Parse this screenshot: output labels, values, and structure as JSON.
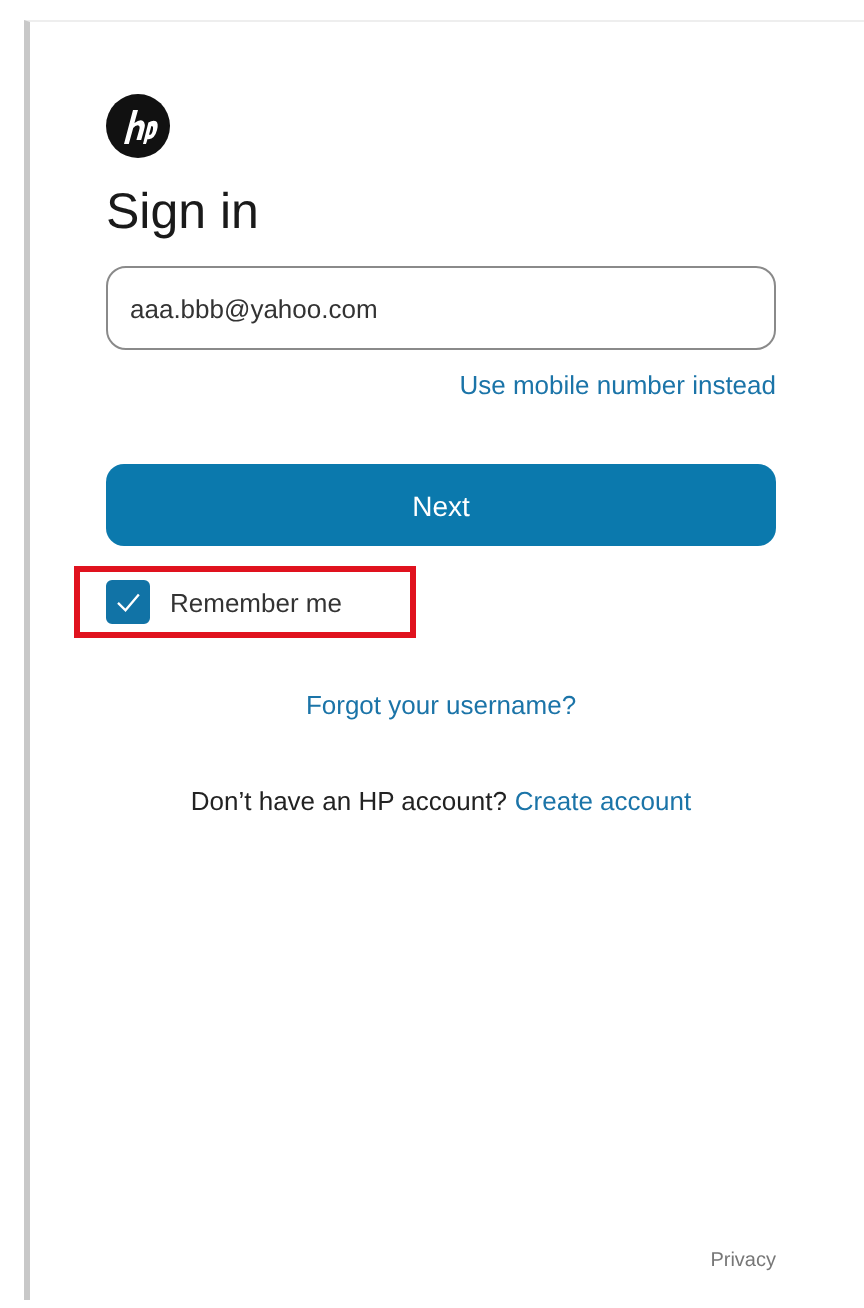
{
  "title": "Sign in",
  "email_field": {
    "value": "aaa.bbb@yahoo.com"
  },
  "alt_link": "Use mobile number instead",
  "next_button": "Next",
  "remember_me": {
    "label": "Remember me",
    "checked": true,
    "highlighted": true
  },
  "forgot_link": "Forgot your username?",
  "signup": {
    "prompt": "Don’t have an HP account?",
    "link": "Create account"
  },
  "footer_link": "Privacy"
}
